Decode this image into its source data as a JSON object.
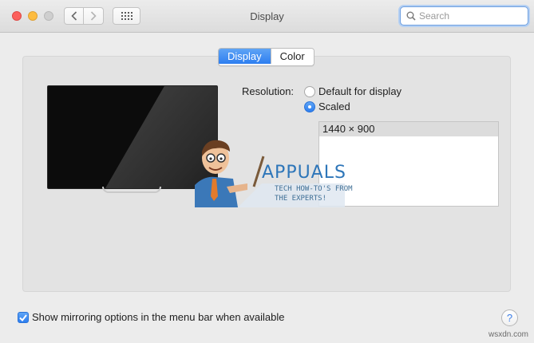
{
  "window": {
    "title": "Display"
  },
  "titlebar": {
    "traffic_lights": [
      "close",
      "minimize",
      "zoom"
    ],
    "nav": {
      "back_icon": "chevron-left-icon",
      "forward_icon": "chevron-right-icon"
    },
    "show_all_icon": "grid-icon"
  },
  "search": {
    "placeholder": "Search",
    "value": ""
  },
  "tabs": [
    {
      "label": "Display",
      "selected": true
    },
    {
      "label": "Color",
      "selected": false
    }
  ],
  "resolution": {
    "label": "Resolution:",
    "options": [
      {
        "label": "Default for display",
        "selected": false
      },
      {
        "label": "Scaled",
        "selected": true
      }
    ],
    "list": [
      "1440 × 900"
    ]
  },
  "watermark": {
    "title": "APPUALS",
    "line1": "TECH HOW-TO'S FROM",
    "line2": "THE EXPERTS!"
  },
  "footer": {
    "mirroring_label": "Show mirroring options in the menu bar when available",
    "mirroring_checked": true,
    "help_label": "?"
  },
  "credit": "wsxdn.com",
  "colors": {
    "accent": "#2d7ef0",
    "close": "#fc605c",
    "minimize": "#fdbc40",
    "watermark": "#2e76b9"
  }
}
